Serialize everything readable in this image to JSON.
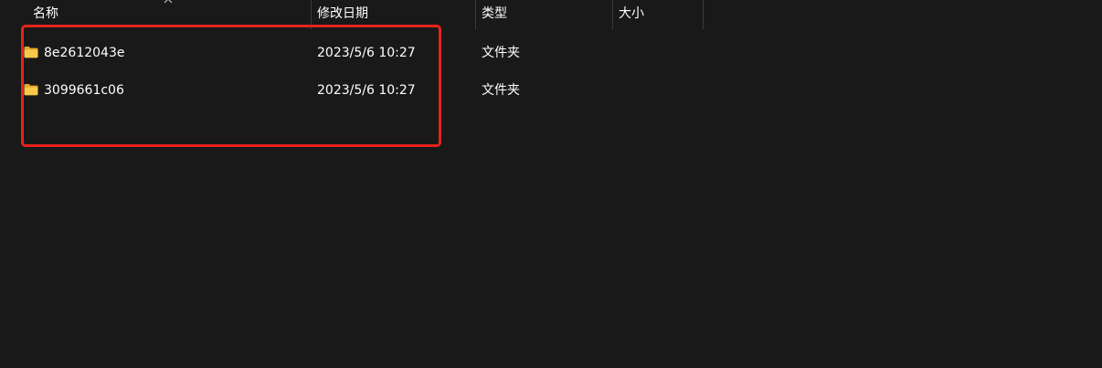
{
  "columns": [
    {
      "label": "名称"
    },
    {
      "label": "修改日期"
    },
    {
      "label": "类型"
    },
    {
      "label": "大小"
    }
  ],
  "sort": {
    "column": "名称",
    "icon": "chevron-up-icon"
  },
  "rows": [
    {
      "name": "8e2612043e",
      "modified": "2023/5/6 10:27",
      "type": "文件夹",
      "size": "",
      "icon": "folder-icon"
    },
    {
      "name": "3099661c06",
      "modified": "2023/5/6 10:27",
      "type": "文件夹",
      "size": "",
      "icon": "folder-icon"
    }
  ],
  "colors": {
    "background": "#191919",
    "text": "#ffffff",
    "divider": "#3a3a3a",
    "folder": "#f5c542",
    "annotation": "#e5231b"
  }
}
